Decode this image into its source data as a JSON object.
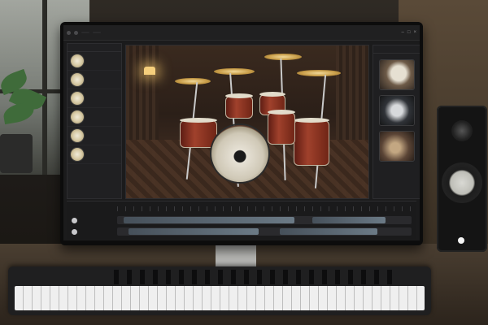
{
  "app": {
    "title": "",
    "tabs": [
      "",
      ""
    ],
    "icons": [
      "minimize-icon",
      "maximize-icon",
      "close-icon"
    ]
  },
  "left_panel": {
    "header": "",
    "items": [
      {
        "label": ""
      },
      {
        "label": ""
      },
      {
        "label": ""
      },
      {
        "label": ""
      },
      {
        "label": ""
      },
      {
        "label": ""
      }
    ]
  },
  "right_panel": {
    "header": "",
    "thumbnails": [
      "",
      "",
      ""
    ]
  },
  "timeline": {
    "track_labels": [
      "",
      ""
    ]
  },
  "colors": {
    "accent": "#6b7a86",
    "drum_shell": "#a0412c",
    "cymbal": "#c99e4a"
  }
}
